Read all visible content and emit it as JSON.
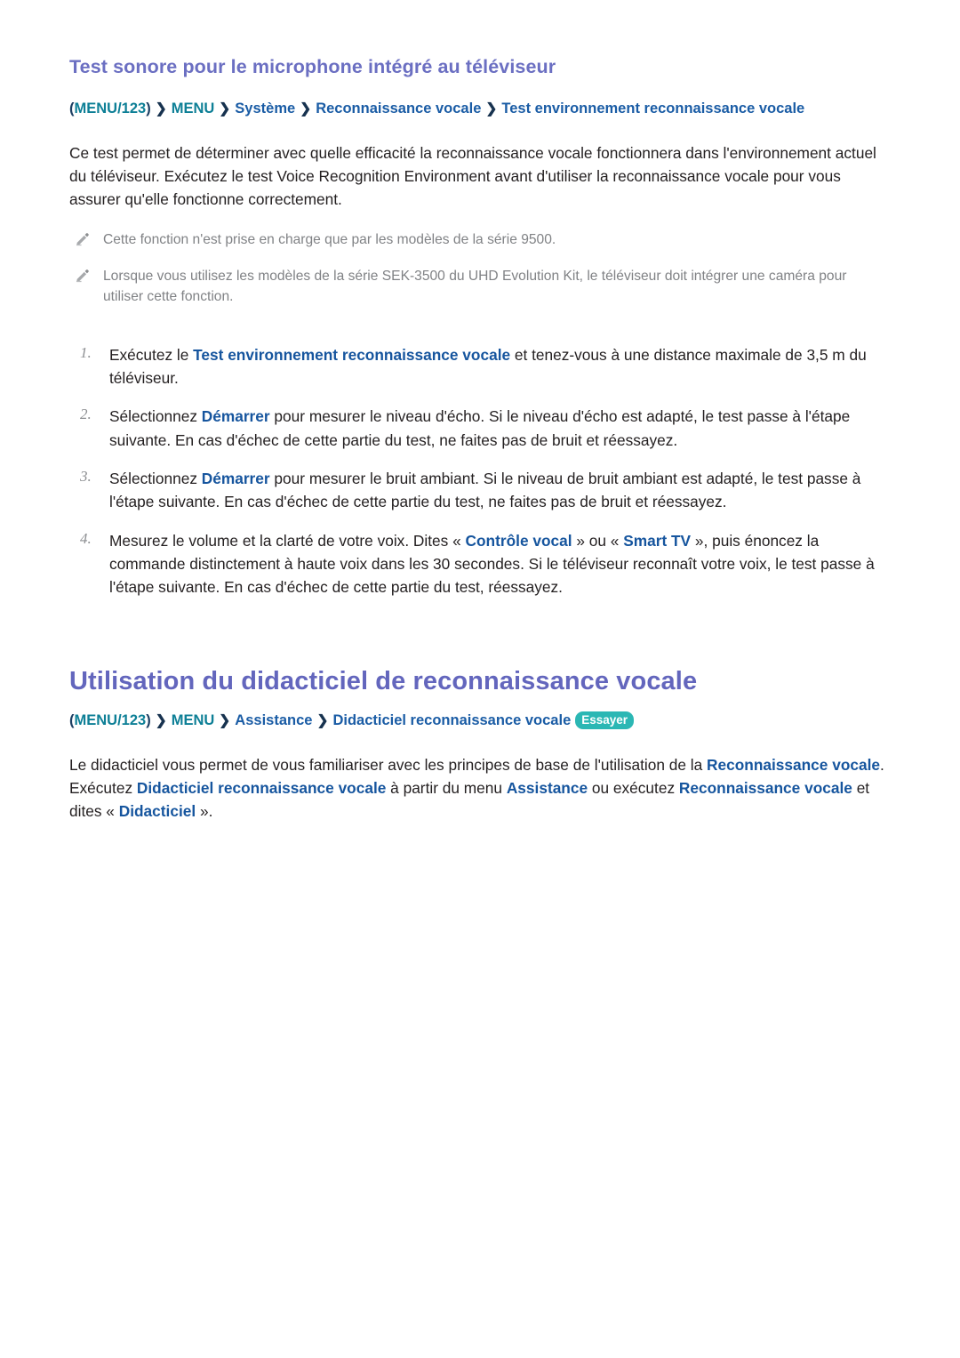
{
  "section1": {
    "heading": "Test sonore pour le microphone intégré au téléviseur",
    "breadcrumb": {
      "open_paren": "(",
      "menu123": "MENU/123",
      "close_paren": ")",
      "sep": "❯",
      "menu": "MENU",
      "item1": "Système",
      "item2": "Reconnaissance vocale",
      "item3": "Test environnement reconnaissance vocale"
    },
    "intro": "Ce test permet de déterminer avec quelle efficacité la reconnaissance vocale fonctionnera dans l'environnement actuel du téléviseur. Exécutez le test Voice Recognition Environment avant d'utiliser la reconnaissance vocale pour vous assurer qu'elle fonctionne correctement.",
    "notes": [
      {
        "icon": "pencil-icon",
        "text": "Cette fonction n'est prise en charge que par les modèles de la série 9500."
      },
      {
        "icon": "pencil-icon",
        "text": "Lorsque vous utilisez les modèles de la série SEK-3500 du UHD Evolution Kit, le téléviseur doit intégrer une caméra pour utiliser cette fonction."
      }
    ],
    "steps": [
      {
        "number": "1.",
        "part1": "Exécutez le ",
        "kw1": "Test environnement reconnaissance vocale",
        "part2": " et tenez-vous à une distance maximale de 3,5 m du téléviseur."
      },
      {
        "number": "2.",
        "part1": "Sélectionnez ",
        "kw1": "Démarrer",
        "part2": " pour mesurer le niveau d'écho. Si le niveau d'écho est adapté, le test passe à l'étape suivante. En cas d'échec de cette partie du test, ne faites pas de bruit et réessayez."
      },
      {
        "number": "3.",
        "part1": "Sélectionnez ",
        "kw1": "Démarrer",
        "part2": " pour mesurer le bruit ambiant. Si le niveau de bruit ambiant est adapté, le test passe à l'étape suivante. En cas d'échec de cette partie du test, ne faites pas de bruit et réessayez."
      },
      {
        "number": "4.",
        "part1": "Mesurez le volume et la clarté de votre voix. Dites « ",
        "kw1": "Contrôle vocal",
        "part2": " » ou « ",
        "kw2": "Smart TV",
        "part3": " », puis énoncez la commande distinctement à haute voix dans les 30 secondes. Si le téléviseur reconnaît votre voix, le test passe à l'étape suivante. En cas d'échec de cette partie du test, réessayez."
      }
    ]
  },
  "section2": {
    "heading": "Utilisation du didacticiel de reconnaissance vocale",
    "breadcrumb": {
      "open_paren": "(",
      "menu123": "MENU/123",
      "close_paren": ")",
      "sep": "❯",
      "menu": "MENU",
      "item1": "Assistance",
      "item2": "Didacticiel reconnaissance vocale",
      "badge": "Essayer"
    },
    "body": {
      "t1": "Le didacticiel vous permet de vous familiariser avec les principes de base de l'utilisation de la ",
      "kw1": "Reconnaissance vocale",
      "t2": ". Exécutez ",
      "kw2": "Didacticiel reconnaissance vocale",
      "t3": " à partir du menu ",
      "kw3": "Assistance",
      "t4": " ou exécutez ",
      "kw4": "Reconnaissance vocale",
      "t5": " et dites « ",
      "kw5": "Didacticiel",
      "t6": " »."
    }
  },
  "colors": {
    "heading_purple": "#6b6fc2",
    "breadcrumb_teal": "#0d7f96",
    "breadcrumb_blue": "#1a5ca5",
    "keyword_blue": "#16559e",
    "note_gray": "#808285",
    "badge_teal": "#2bb7b4"
  }
}
